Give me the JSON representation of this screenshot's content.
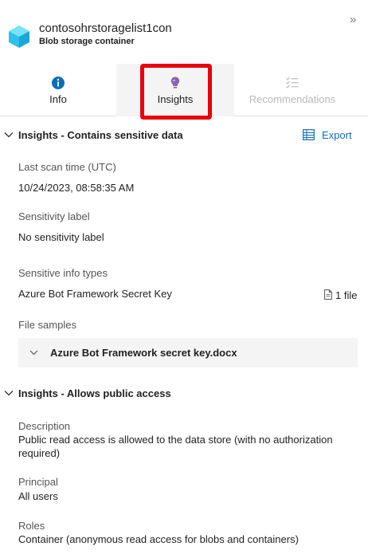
{
  "header": {
    "title": "contosohrstoragelist1con",
    "subtitle": "Blob storage container",
    "collapse_glyph": "»"
  },
  "tabs": [
    {
      "label": "Info",
      "icon": "info-icon",
      "state": "default"
    },
    {
      "label": "Insights",
      "icon": "lightbulb-icon",
      "state": "selected"
    },
    {
      "label": "Recommendations",
      "icon": "checklist-icon",
      "state": "disabled"
    }
  ],
  "colors": {
    "accent": "#0f6cbd",
    "highlight_box": "#e8000b",
    "info_icon": "#0f6cbd",
    "insights_icon": "#8764b8",
    "disabled_text": "#b9b9b9",
    "cube": "#3ccbf4"
  },
  "insights_sensitive": {
    "title": "Insights - Contains sensitive data",
    "export_label": "Export",
    "last_scan_label": "Last scan time (UTC)",
    "last_scan_value": "10/24/2023, 08:58:35 AM",
    "sensitivity_label_label": "Sensitivity label",
    "sensitivity_label_value": "No sensitivity label",
    "info_types_label": "Sensitive info types",
    "info_types_value": "Azure Bot Framework Secret Key",
    "info_types_count": "1 file",
    "file_samples_label": "File samples",
    "file_sample_name": "Azure Bot Framework secret key.docx"
  },
  "insights_public": {
    "title": "Insights - Allows public access",
    "description_label": "Description",
    "description_value": "Public read access is allowed to the data store (with no authorization required)",
    "principal_label": "Principal",
    "principal_value": "All users",
    "roles_label": "Roles",
    "roles_value": "Container (anonymous read access for blobs and containers)"
  }
}
